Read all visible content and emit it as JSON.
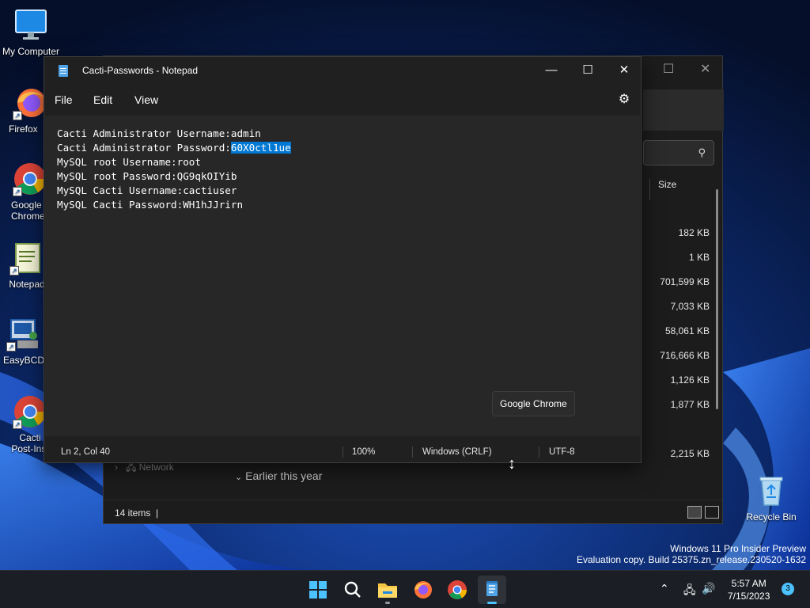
{
  "desktop": {
    "icons": [
      {
        "label": "My Computer"
      },
      {
        "label": "Firefox"
      },
      {
        "label": "Google Chrome"
      },
      {
        "label": "Notepad"
      },
      {
        "label": "EasyBCD"
      },
      {
        "label": "Cacti Post-Inst"
      },
      {
        "label": "Recycle Bin"
      }
    ]
  },
  "explorer": {
    "column_size": "Size",
    "sizes": [
      "182 KB",
      "1 KB",
      "701,599 KB",
      "7,033 KB",
      "58,061 KB",
      "716,666 KB",
      "1,126 KB",
      "1,877 KB",
      "2,215 KB"
    ],
    "nav_network": "Network",
    "group_header": "Earlier this year",
    "items_count": "14 items"
  },
  "notepad": {
    "title": "Cacti-Passwords - Notepad",
    "menu": {
      "file": "File",
      "edit": "Edit",
      "view": "View"
    },
    "lines": [
      {
        "text": "Cacti Administrator Username:admin"
      },
      {
        "prefix": "Cacti Administrator Password:",
        "selected": "60X0ctl1ue"
      },
      {
        "text": "MySQL root Username:root"
      },
      {
        "text": "MySQL root Password:QG9qkOIYib"
      },
      {
        "text": "MySQL Cacti Username:cactiuser"
      },
      {
        "text": "MySQL Cacti Password:WH1hJJrirn"
      }
    ],
    "status": {
      "position": "Ln 2, Col 40",
      "zoom": "100%",
      "line_ending": "Windows (CRLF)",
      "encoding": "UTF-8"
    },
    "tooltip": "Google Chrome"
  },
  "watermark": {
    "line1": "Windows 11 Pro Insider Preview",
    "line2": "Evaluation copy. Build 25375.zn_release.230520-1632"
  },
  "taskbar": {
    "time": "5:57 AM",
    "date": "7/15/2023",
    "notifications": "3",
    "active_app": "Notepad"
  },
  "colors": {
    "accent": "#0078d4",
    "taskbar_accent": "#4cc2ff"
  }
}
